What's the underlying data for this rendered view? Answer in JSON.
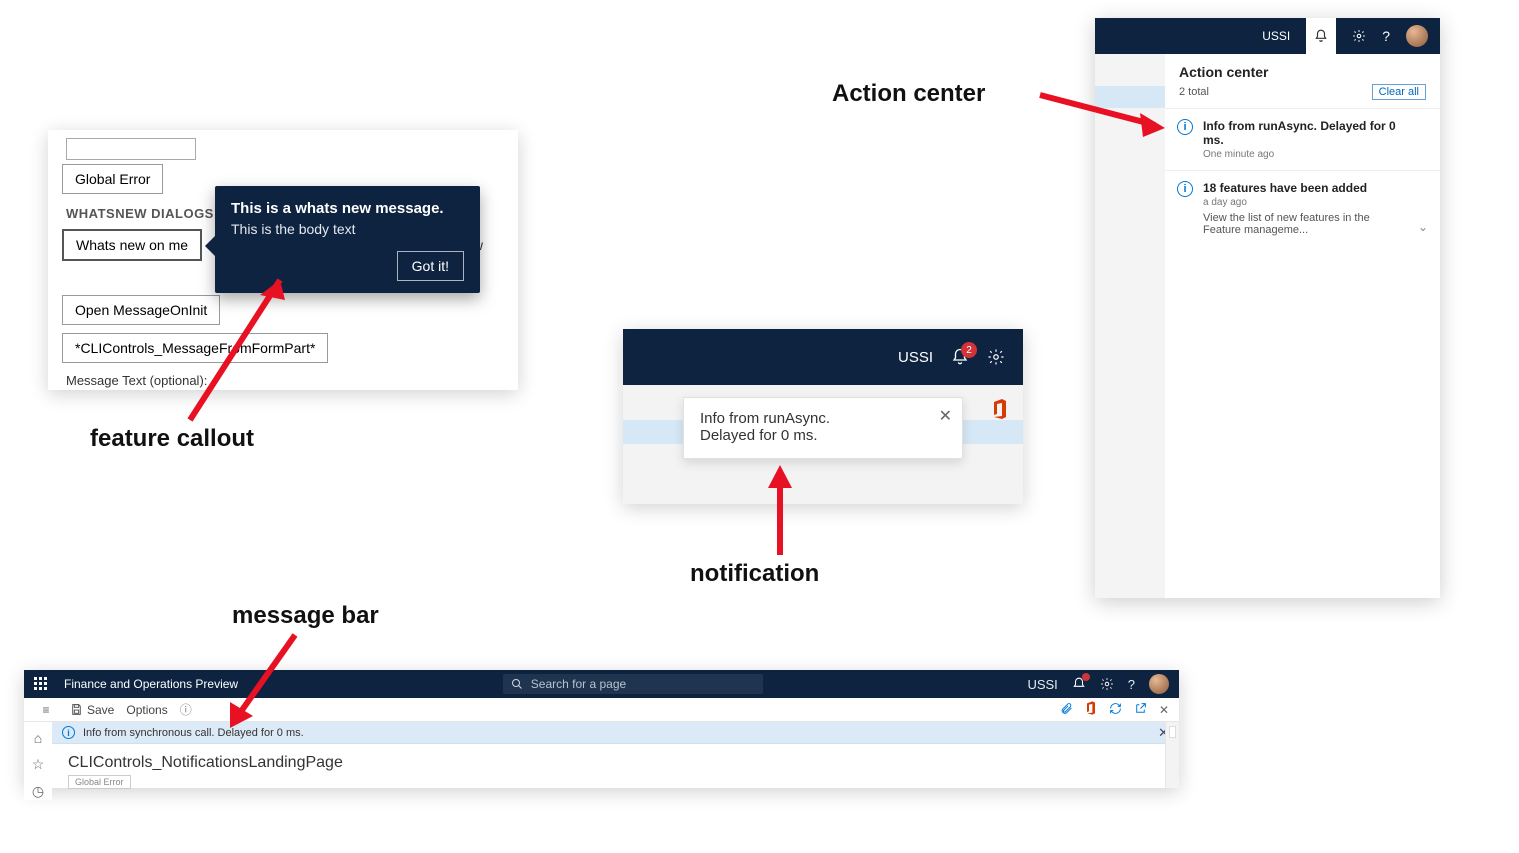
{
  "annotations": {
    "feature_callout": "feature callout",
    "notification": "notification",
    "action_center": "Action center",
    "message_bar": "message bar"
  },
  "p1": {
    "global_error_label": "Global Error",
    "section_label": "WHATSNEW DIALOGS",
    "whats_new_label": "Whats new on me",
    "open_init_label": "Open MessageOnInit",
    "from_formpart_label": "*CLIControls_MessageFromFormPart*",
    "partial_whats_new_trail": "ts new",
    "msg_text_label": "Message Text (optional):",
    "callout": {
      "title": "This is a whats new message.",
      "body": "This is the body text",
      "gotit": "Got it!"
    }
  },
  "p2": {
    "org": "USSI",
    "badge": "2",
    "toast_line1": "Info from runAsync.",
    "toast_line2": "Delayed for 0 ms."
  },
  "p3": {
    "org": "USSI",
    "title": "Action center",
    "count_label": "2 total",
    "clear_label": "Clear all",
    "items": [
      {
        "title": "Info from runAsync. Delayed for 0 ms.",
        "sub": "One minute ago",
        "desc": ""
      },
      {
        "title": "18 features have been added",
        "sub": "a day ago",
        "desc": "View the list of new features in the Feature manageme..."
      }
    ]
  },
  "p4": {
    "app_title": "Finance and Operations Preview",
    "search_placeholder": "Search for a page",
    "org": "USSI",
    "save_label": "Save",
    "options_label": "Options",
    "msg_text": "Info from synchronous call. Delayed for 0 ms.",
    "page_title": "CLIControls_NotificationsLandingPage",
    "ghost_btn": "Global Error"
  }
}
